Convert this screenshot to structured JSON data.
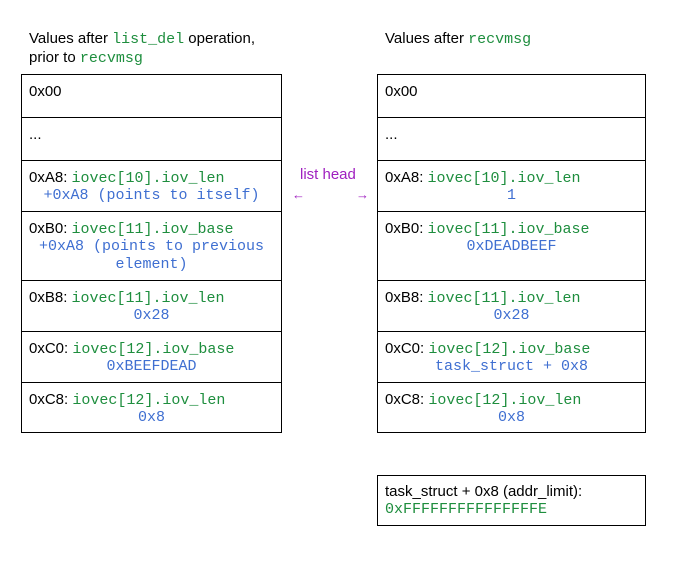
{
  "left": {
    "heading": {
      "prefix": "Values after ",
      "code": "list_del",
      "suffix": " operation,",
      "line2_prefix": "prior to ",
      "line2_code": "recvmsg"
    },
    "rows": [
      {
        "addr": "0x00"
      },
      {
        "addr": "..."
      },
      {
        "addr": "0xA8: ",
        "field": "iovec[10].iov_len",
        "value": "+0xA8 (points to itself)"
      },
      {
        "addr": "0xB0: ",
        "field": "iovec[11].iov_base",
        "value_line1": "+0xA8 (points to previous",
        "value_line2": "element)"
      },
      {
        "addr": "0xB8: ",
        "field": "iovec[11].iov_len",
        "value": "0x28"
      },
      {
        "addr": "0xC0: ",
        "field": "iovec[12].iov_base",
        "value": "0xBEEFDEAD"
      },
      {
        "addr": "0xC8: ",
        "field": "iovec[12].iov_len",
        "value": "0x8"
      }
    ]
  },
  "right": {
    "heading": {
      "prefix": "Values after ",
      "code": "recvmsg"
    },
    "rows": [
      {
        "addr": "0x00"
      },
      {
        "addr": "..."
      },
      {
        "addr": "0xA8: ",
        "field": "iovec[10].iov_len",
        "value": "1"
      },
      {
        "addr": "0xB0: ",
        "field": "iovec[11].iov_base",
        "value": "0xDEADBEEF"
      },
      {
        "addr": "0xB8: ",
        "field": "iovec[11].iov_len",
        "value": "0x28"
      },
      {
        "addr": "0xC0: ",
        "field": "iovec[12].iov_base",
        "value": "task_struct + 0x8"
      },
      {
        "addr": "0xC8: ",
        "field": "iovec[12].iov_len",
        "value": "0x8"
      }
    ]
  },
  "list_head": {
    "label": "list head",
    "arrow_left": "←",
    "arrow_right": "→"
  },
  "addr_limit": {
    "label": "task_struct + 0x8 (addr_limit):",
    "value": "0xFFFFFFFFFFFFFFFE"
  },
  "colors": {
    "code": "#1e8e3e",
    "value": "#3f6fd1",
    "list_head": "#a020c0"
  }
}
